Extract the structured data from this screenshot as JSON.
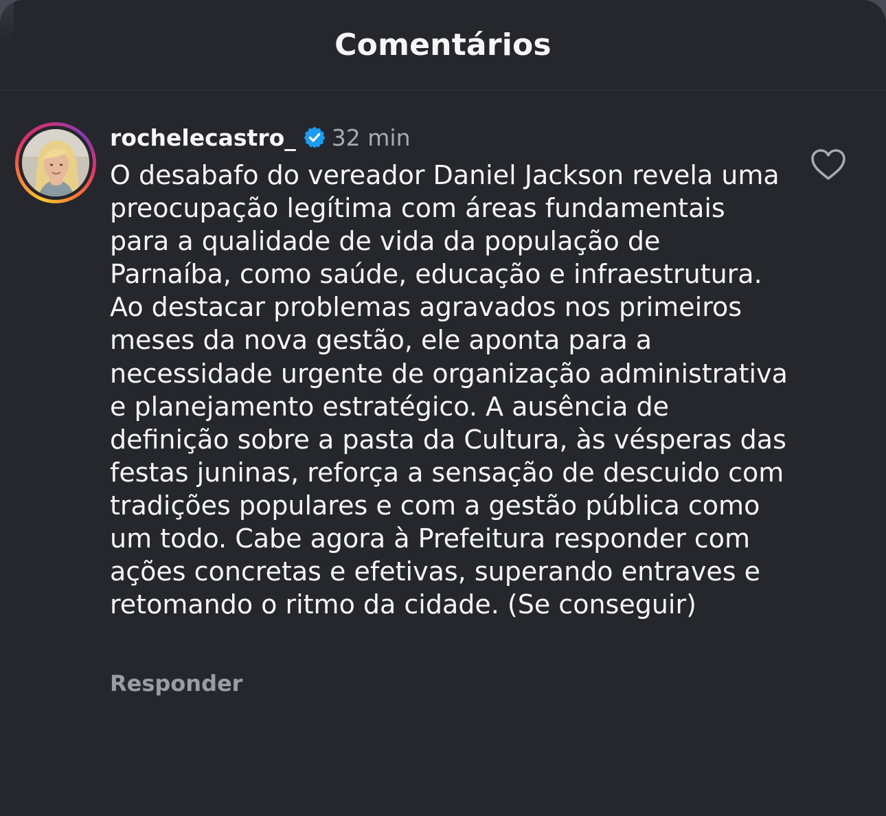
{
  "header": {
    "title": "Comentários"
  },
  "comment": {
    "username": "rochelecastro_",
    "verified_icon": "verified-badge-icon",
    "timestamp": "32 min",
    "text": "O desabafo do vereador Daniel Jackson revela uma preocupação legítima com áreas fundamentais para a qualidade de vida da população de Parnaíba, como saúde, educação e infraestrutura. Ao destacar problemas agravados nos primeiros meses da nova gestão, ele aponta para a necessidade urgente de organização administrativa e planejamento estratégico. A ausência de definição sobre a pasta da Cultura, às vésperas das festas juninas, reforça a sensação de descuido com tradições populares e com a gestão pública como um todo. Cabe agora à Prefeitura responder com ações concretas e efetivas, superando entraves e retomando o ritmo da cidade. (Se conseguir)",
    "reply_label": "Responder",
    "like_icon": "heart-outline-icon"
  },
  "colors": {
    "background": "#25272c",
    "text_primary": "#f5f5f5",
    "text_secondary": "#a8abb2",
    "verified_blue": "#1d9bf0"
  }
}
